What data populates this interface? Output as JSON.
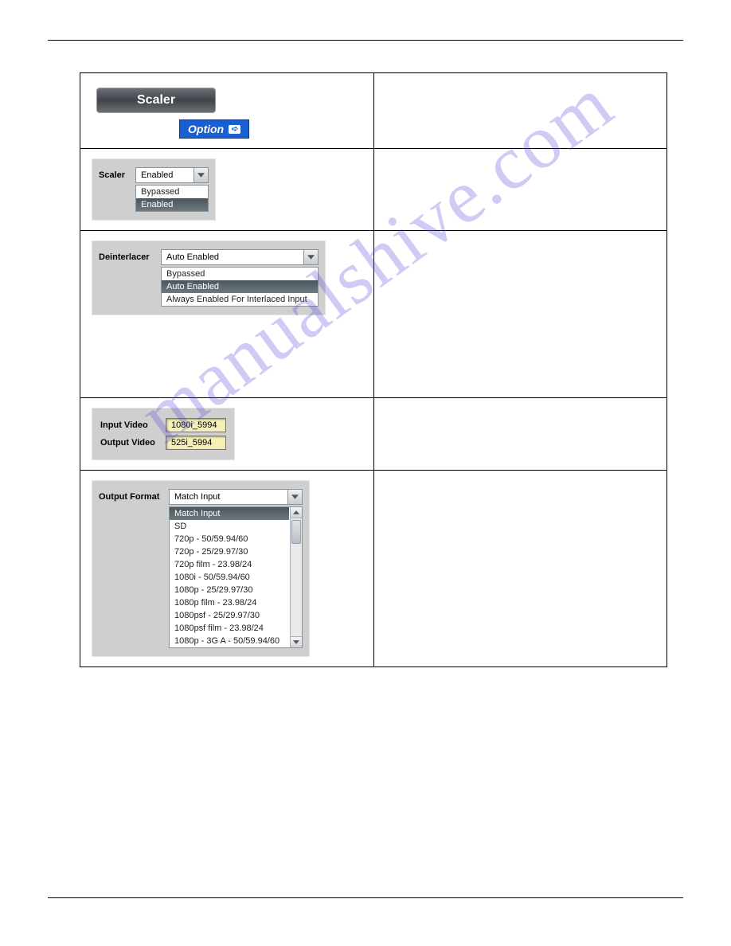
{
  "watermark": "manualshive.com",
  "header": {
    "title": "Scaler",
    "option_label": "Option"
  },
  "scaler": {
    "label": "Scaler",
    "selected": "Enabled",
    "options": [
      "Bypassed",
      "Enabled"
    ],
    "selected_index": 1
  },
  "deinterlacer": {
    "label": "Deinterlacer",
    "selected": "Auto Enabled",
    "options": [
      "Bypassed",
      "Auto Enabled",
      "Always Enabled For Interlaced Input"
    ],
    "selected_index": 1
  },
  "status": {
    "input_label": "Input Video",
    "input_value": "1080i_5994",
    "output_label": "Output Video",
    "output_value": "525i_5994"
  },
  "output_format": {
    "label": "Output Format",
    "selected": "Match Input",
    "options": [
      "Match Input",
      "SD",
      "720p - 50/59.94/60",
      "720p - 25/29.97/30",
      "720p film - 23.98/24",
      "1080i - 50/59.94/60",
      "1080p - 25/29.97/30",
      "1080p film - 23.98/24",
      "1080psf - 25/29.97/30",
      "1080psf film - 23.98/24",
      "1080p - 3G A - 50/59.94/60"
    ],
    "selected_index": 0
  }
}
